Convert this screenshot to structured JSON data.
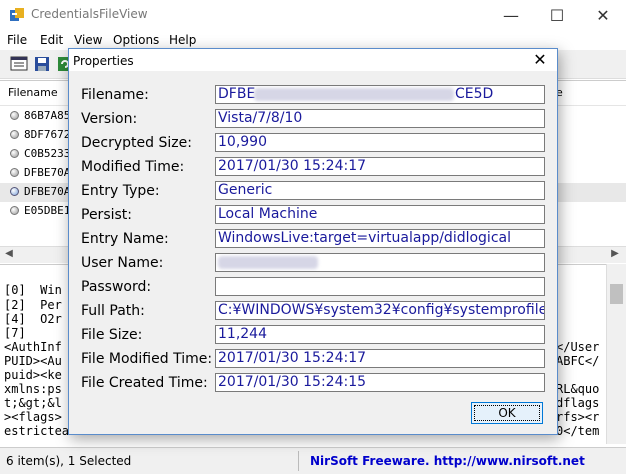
{
  "app": {
    "title": "CredentialsFileView",
    "minimize_glyph": "—",
    "maximize_glyph": "☐",
    "close_glyph": "✕"
  },
  "menu": [
    "File",
    "Edit",
    "View",
    "Options",
    "Help"
  ],
  "toolbar": {
    "icons": [
      "properties-icon",
      "save-icon",
      "refresh-icon"
    ]
  },
  "list": {
    "column_filename": "Filename",
    "column_right_partial": "e",
    "rows": [
      {
        "text": "86B7A85",
        "color": "gray"
      },
      {
        "text": "8DF7672",
        "color": "gray"
      },
      {
        "text": "C0B5233",
        "color": "gray"
      },
      {
        "text": "DFBE70A",
        "color": "gray"
      },
      {
        "text": "DFBE70A",
        "color": "blue"
      },
      {
        "text": "E05DBE1",
        "color": "gray"
      }
    ]
  },
  "lower_pane": {
    "lines": [
      "[0]  Win",
      "[2]  Per",
      "[4]  O2r",
      "[7]",
      "<AuthInf",
      "PUID><Au",
      "puid><ke",
      "xmlns:ps",
      "t;&gt;&l",
      "><flags>",
      "estricteada"
    ],
    "right_fragments": [
      "</User",
      "ABFC</",
      "RL&quo",
      "dflags",
      "rfs><r",
      "0</tem"
    ]
  },
  "status": {
    "items": "6 item(s), 1 Selected",
    "brand": "NirSoft Freeware.  http://www.nirsoft.net"
  },
  "dialog": {
    "title": "Properties",
    "close_glyph": "✕",
    "ok": "OK",
    "fields": {
      "filename": {
        "label": "Filename:",
        "prefix": "DFBE",
        "suffix": "CE5D"
      },
      "version": {
        "label": "Version:",
        "value": "Vista/7/8/10"
      },
      "decrypted_size": {
        "label": "Decrypted Size:",
        "value": "10,990"
      },
      "modified_time": {
        "label": "Modified Time:",
        "value": "2017/01/30 15:24:17"
      },
      "entry_type": {
        "label": "Entry Type:",
        "value": "Generic"
      },
      "persist": {
        "label": "Persist:",
        "value": "Local Machine"
      },
      "entry_name": {
        "label": "Entry Name:",
        "value": "WindowsLive:target=virtualapp/didlogical"
      },
      "user_name": {
        "label": "User Name:",
        "value": ""
      },
      "password": {
        "label": "Password:",
        "value": ""
      },
      "full_path": {
        "label": "Full Path:",
        "value": "C:¥WINDOWS¥system32¥config¥systemprofile¥"
      },
      "file_size": {
        "label": "File Size:",
        "value": "11,244"
      },
      "file_modified_time": {
        "label": "File Modified Time:",
        "value": "2017/01/30 15:24:17"
      },
      "file_created_time": {
        "label": "File Created Time:",
        "value": "2017/01/30 15:24:15"
      }
    }
  }
}
